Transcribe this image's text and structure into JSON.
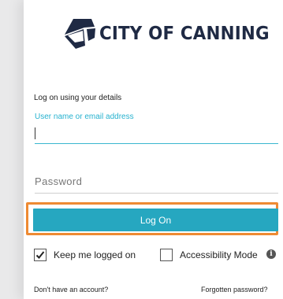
{
  "brand": {
    "name": "CITY OF CANNING",
    "color": "#1f2a44"
  },
  "login": {
    "heading": "Log on using your details",
    "username_label": "User name or email address",
    "password_placeholder": "Password",
    "logon_label": "Log On",
    "keep_logged_on_label": "Keep me logged on",
    "keep_logged_on_checked": true,
    "accessibility_label": "Accessibility Mode",
    "accessibility_checked": false,
    "info_icon": "info-icon",
    "info_glyph": "i"
  },
  "links": {
    "no_account": "Don't have an account?",
    "forgot_password": "Forgotten password?"
  },
  "colors": {
    "accent": "#26a7c0",
    "highlight": "#ee8a33",
    "label": "#26b2cf"
  }
}
